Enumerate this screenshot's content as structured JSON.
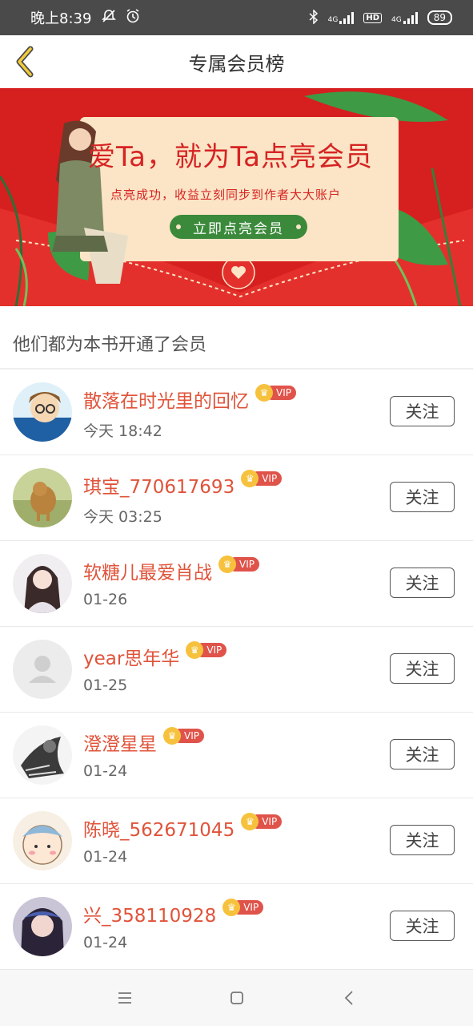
{
  "status": {
    "time": "晚上8:39",
    "network1": "4G",
    "hd": "HD",
    "network2": "4G",
    "battery": "89"
  },
  "header": {
    "title": "专属会员榜",
    "back_icon": "chevron-left-icon"
  },
  "banner": {
    "headline": "爱Ta，就为Ta点亮会员",
    "subtitle": "点亮成功，收益立刻同步到作者大大账户",
    "cta": "立即点亮会员",
    "bg_color": "#d61f1f",
    "card_color": "#fbe5c6",
    "cta_color": "#3b8a3b"
  },
  "section_title": "他们都为本书开通了会员",
  "vip_label": "VIP",
  "follow_label": "关注",
  "members": [
    {
      "name": "散落在时光里的回忆",
      "time": "今天 18:42"
    },
    {
      "name": "琪宝_770617693",
      "time": "今天 03:25"
    },
    {
      "name": "软糖儿最爱肖战",
      "time": "01-26"
    },
    {
      "name": "year思年华",
      "time": "01-25"
    },
    {
      "name": "澄澄星星",
      "time": "01-24"
    },
    {
      "name": "陈晓_562671045",
      "time": "01-24"
    },
    {
      "name": "兴_358110928",
      "time": "01-24"
    }
  ],
  "colors": {
    "accent": "#e0533a",
    "vip": "#e0534a",
    "crown": "#f6c23e"
  }
}
